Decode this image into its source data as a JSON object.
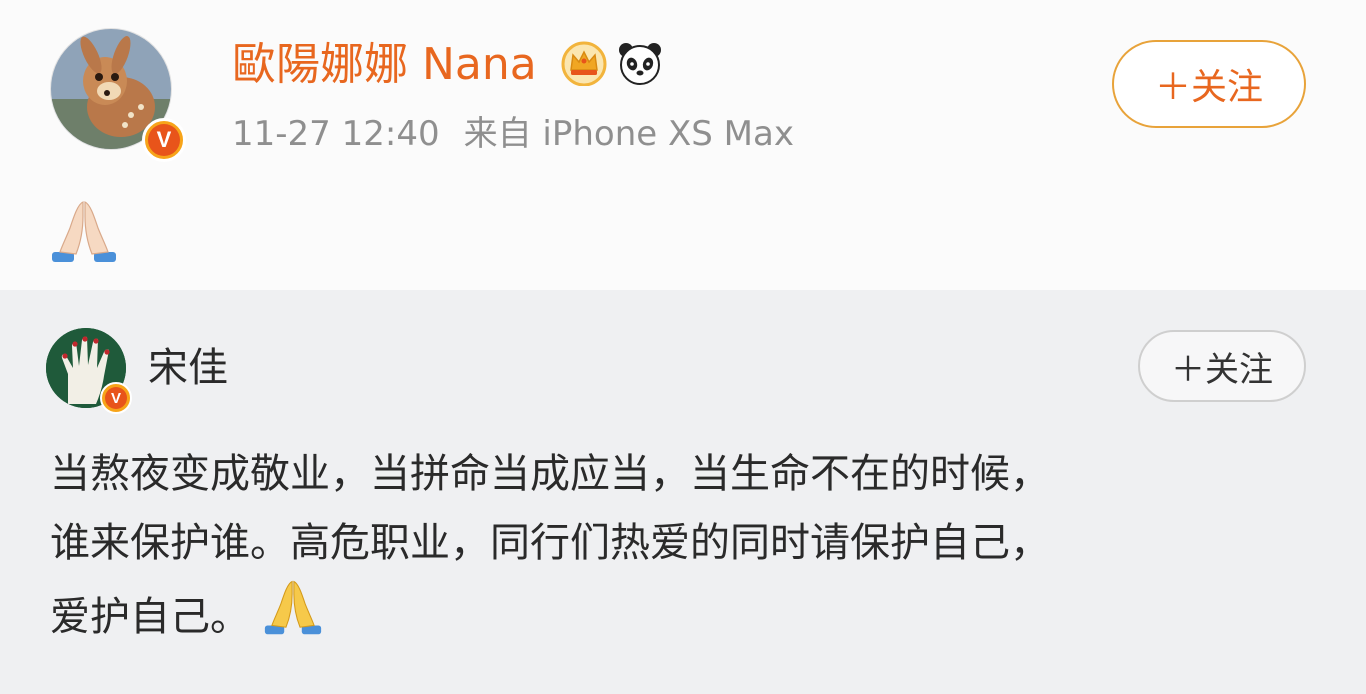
{
  "post": {
    "author": {
      "name": "歐陽娜娜 Nana",
      "verified_icon": "verified-v-icon",
      "verified_text": "V",
      "badges": [
        "crown-icon",
        "panda-icon"
      ]
    },
    "meta": {
      "time": "11-27 12:40",
      "source": "来自 iPhone XS Max"
    },
    "follow_label": "＋关注",
    "content_emoji": "folded-hands-emoji"
  },
  "repost": {
    "author": {
      "name": "宋佳",
      "verified_text": "V"
    },
    "follow_label": "＋关注",
    "text_lines": [
      "当熬夜变成敬业，当拼命当成应当，当生命不在的时候，",
      "谁来保护谁。高危职业，同行们热爱的同时请保护自己，",
      "爱护自己。"
    ],
    "trailing_emoji": "folded-hands-emoji"
  },
  "colors": {
    "name_orange": "#e8671f",
    "meta_gray": "#8f8f8f",
    "repost_bg": "#eff0f2",
    "badge_orange": "#f7a419"
  }
}
